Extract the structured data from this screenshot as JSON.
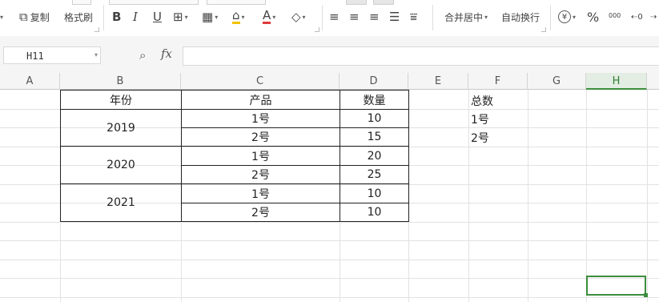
{
  "toolbar": {
    "copy_label": "复制",
    "format_painter_label": "格式刷",
    "bold_label": "B",
    "italic_label": "I",
    "underline_label": "U",
    "merge_center_label": "合并居中",
    "wrap_text_label": "自动换行",
    "currency_symbol": "¥",
    "percent_symbol": "%",
    "thousands_label": "000",
    "font_color": "#e03b3b",
    "fill_color": "#f2c200"
  },
  "formula_bar": {
    "name_box": "H11",
    "fx_label": "fx",
    "formula_value": ""
  },
  "columns": [
    "A",
    "B",
    "C",
    "D",
    "E",
    "F",
    "G",
    "H"
  ],
  "selected_column": "H",
  "table": {
    "headers": [
      "年份",
      "产品",
      "数量"
    ],
    "year_groups": [
      "2019",
      "2020",
      "2021"
    ],
    "rows": [
      {
        "product": "1号",
        "qty": "10"
      },
      {
        "product": "2号",
        "qty": "15"
      },
      {
        "product": "1号",
        "qty": "20"
      },
      {
        "product": "2号",
        "qty": "25"
      },
      {
        "product": "1号",
        "qty": "10"
      },
      {
        "product": "2号",
        "qty": "10"
      }
    ]
  },
  "summary": {
    "header": "总数",
    "items": [
      "1号",
      "2号"
    ]
  },
  "accent_color": "#3c8d3c"
}
